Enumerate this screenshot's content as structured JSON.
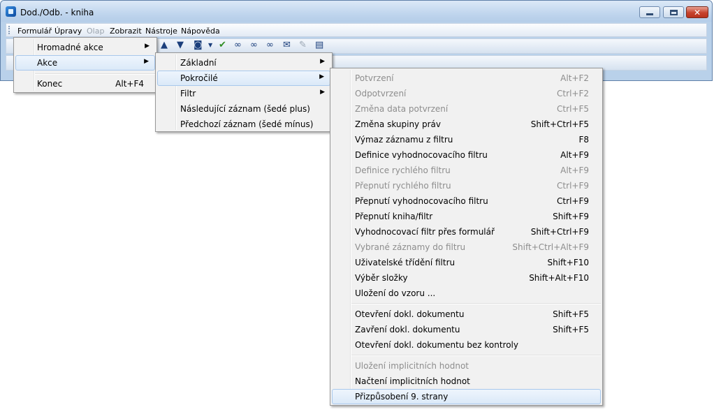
{
  "window": {
    "title": "Dod./Odb. - kniha",
    "close_glyph": "✕"
  },
  "menubar": [
    {
      "label": "Formulář",
      "disabled": false
    },
    {
      "label": "Úpravy",
      "disabled": false
    },
    {
      "label": "Olap",
      "disabled": true
    },
    {
      "label": "Zobrazit",
      "disabled": false
    },
    {
      "label": "Nástroje",
      "disabled": false
    },
    {
      "label": "Nápověda",
      "disabled": false
    }
  ],
  "toolbar_icons": [
    "arrow-up-icon",
    "arrow-down-icon",
    "camera-icon",
    "dropdown-icon",
    "check-arrow-icon",
    "binoculars-icon",
    "binoculars-next-icon",
    "binoculars-prev-icon",
    "envelope-icon",
    "edit-doc-icon",
    "attachment-icon"
  ],
  "menu1": [
    {
      "label": "Hromadné akce",
      "submenu": true
    },
    {
      "label": "Akce",
      "submenu": true,
      "highlighted": true
    },
    {
      "label": "Konec",
      "shortcut": "Alt+F4"
    }
  ],
  "menu2": [
    {
      "label": "Základní",
      "submenu": true
    },
    {
      "label": "Pokročilé",
      "submenu": true,
      "highlighted": true
    },
    {
      "label": "Filtr",
      "submenu": true
    },
    {
      "label": "Následující záznam (šedé plus)"
    },
    {
      "label": "Předchozí záznam (šedé mínus)"
    }
  ],
  "menu3": {
    "group1": [
      {
        "label": "Potvrzení",
        "shortcut": "Alt+F2",
        "disabled": true
      },
      {
        "label": "Odpotvrzení",
        "shortcut": "Ctrl+F2",
        "disabled": true
      },
      {
        "label": "Změna data potvrzení",
        "shortcut": "Ctrl+F5",
        "disabled": true
      },
      {
        "label": "Změna skupiny práv",
        "shortcut": "Shift+Ctrl+F5"
      },
      {
        "label": "Výmaz záznamu z filtru",
        "shortcut": "F8"
      },
      {
        "label": "Definice vyhodnocovacího filtru",
        "shortcut": "Alt+F9"
      },
      {
        "label": "Definice rychlého filtru",
        "shortcut": "Alt+F9",
        "disabled": true
      },
      {
        "label": "Přepnutí rychlého filtru",
        "shortcut": "Ctrl+F9",
        "disabled": true
      },
      {
        "label": "Přepnutí vyhodnocovacího filtru",
        "shortcut": "Ctrl+F9"
      },
      {
        "label": "Přepnutí kniha/filtr",
        "shortcut": "Shift+F9"
      },
      {
        "label": "Vyhodnocovací filtr přes formulář",
        "shortcut": "Shift+Ctrl+F9"
      },
      {
        "label": "Vybrané záznamy do filtru",
        "shortcut": "Shift+Ctrl+Alt+F9",
        "disabled": true
      },
      {
        "label": "Uživatelské třídění filtru",
        "shortcut": "Shift+F10"
      },
      {
        "label": "Výběr složky",
        "shortcut": "Shift+Alt+F10"
      },
      {
        "label": "Uložení do vzoru ...",
        "shortcut": ""
      }
    ],
    "group2": [
      {
        "label": "Otevření dokl. dokumentu",
        "shortcut": "Shift+F5"
      },
      {
        "label": "Zavření dokl. dokumentu",
        "shortcut": "Shift+F5"
      },
      {
        "label": "Otevření dokl. dokumentu bez kontroly",
        "shortcut": ""
      }
    ],
    "group3": [
      {
        "label": "Uložení implicitních hodnot",
        "shortcut": "",
        "disabled": true
      },
      {
        "label": "Načtení implicitních hodnot",
        "shortcut": ""
      },
      {
        "label": "Přizpůsobení  9. strany",
        "shortcut": "",
        "highlighted": true
      }
    ]
  },
  "arrow_glyph": "▶"
}
